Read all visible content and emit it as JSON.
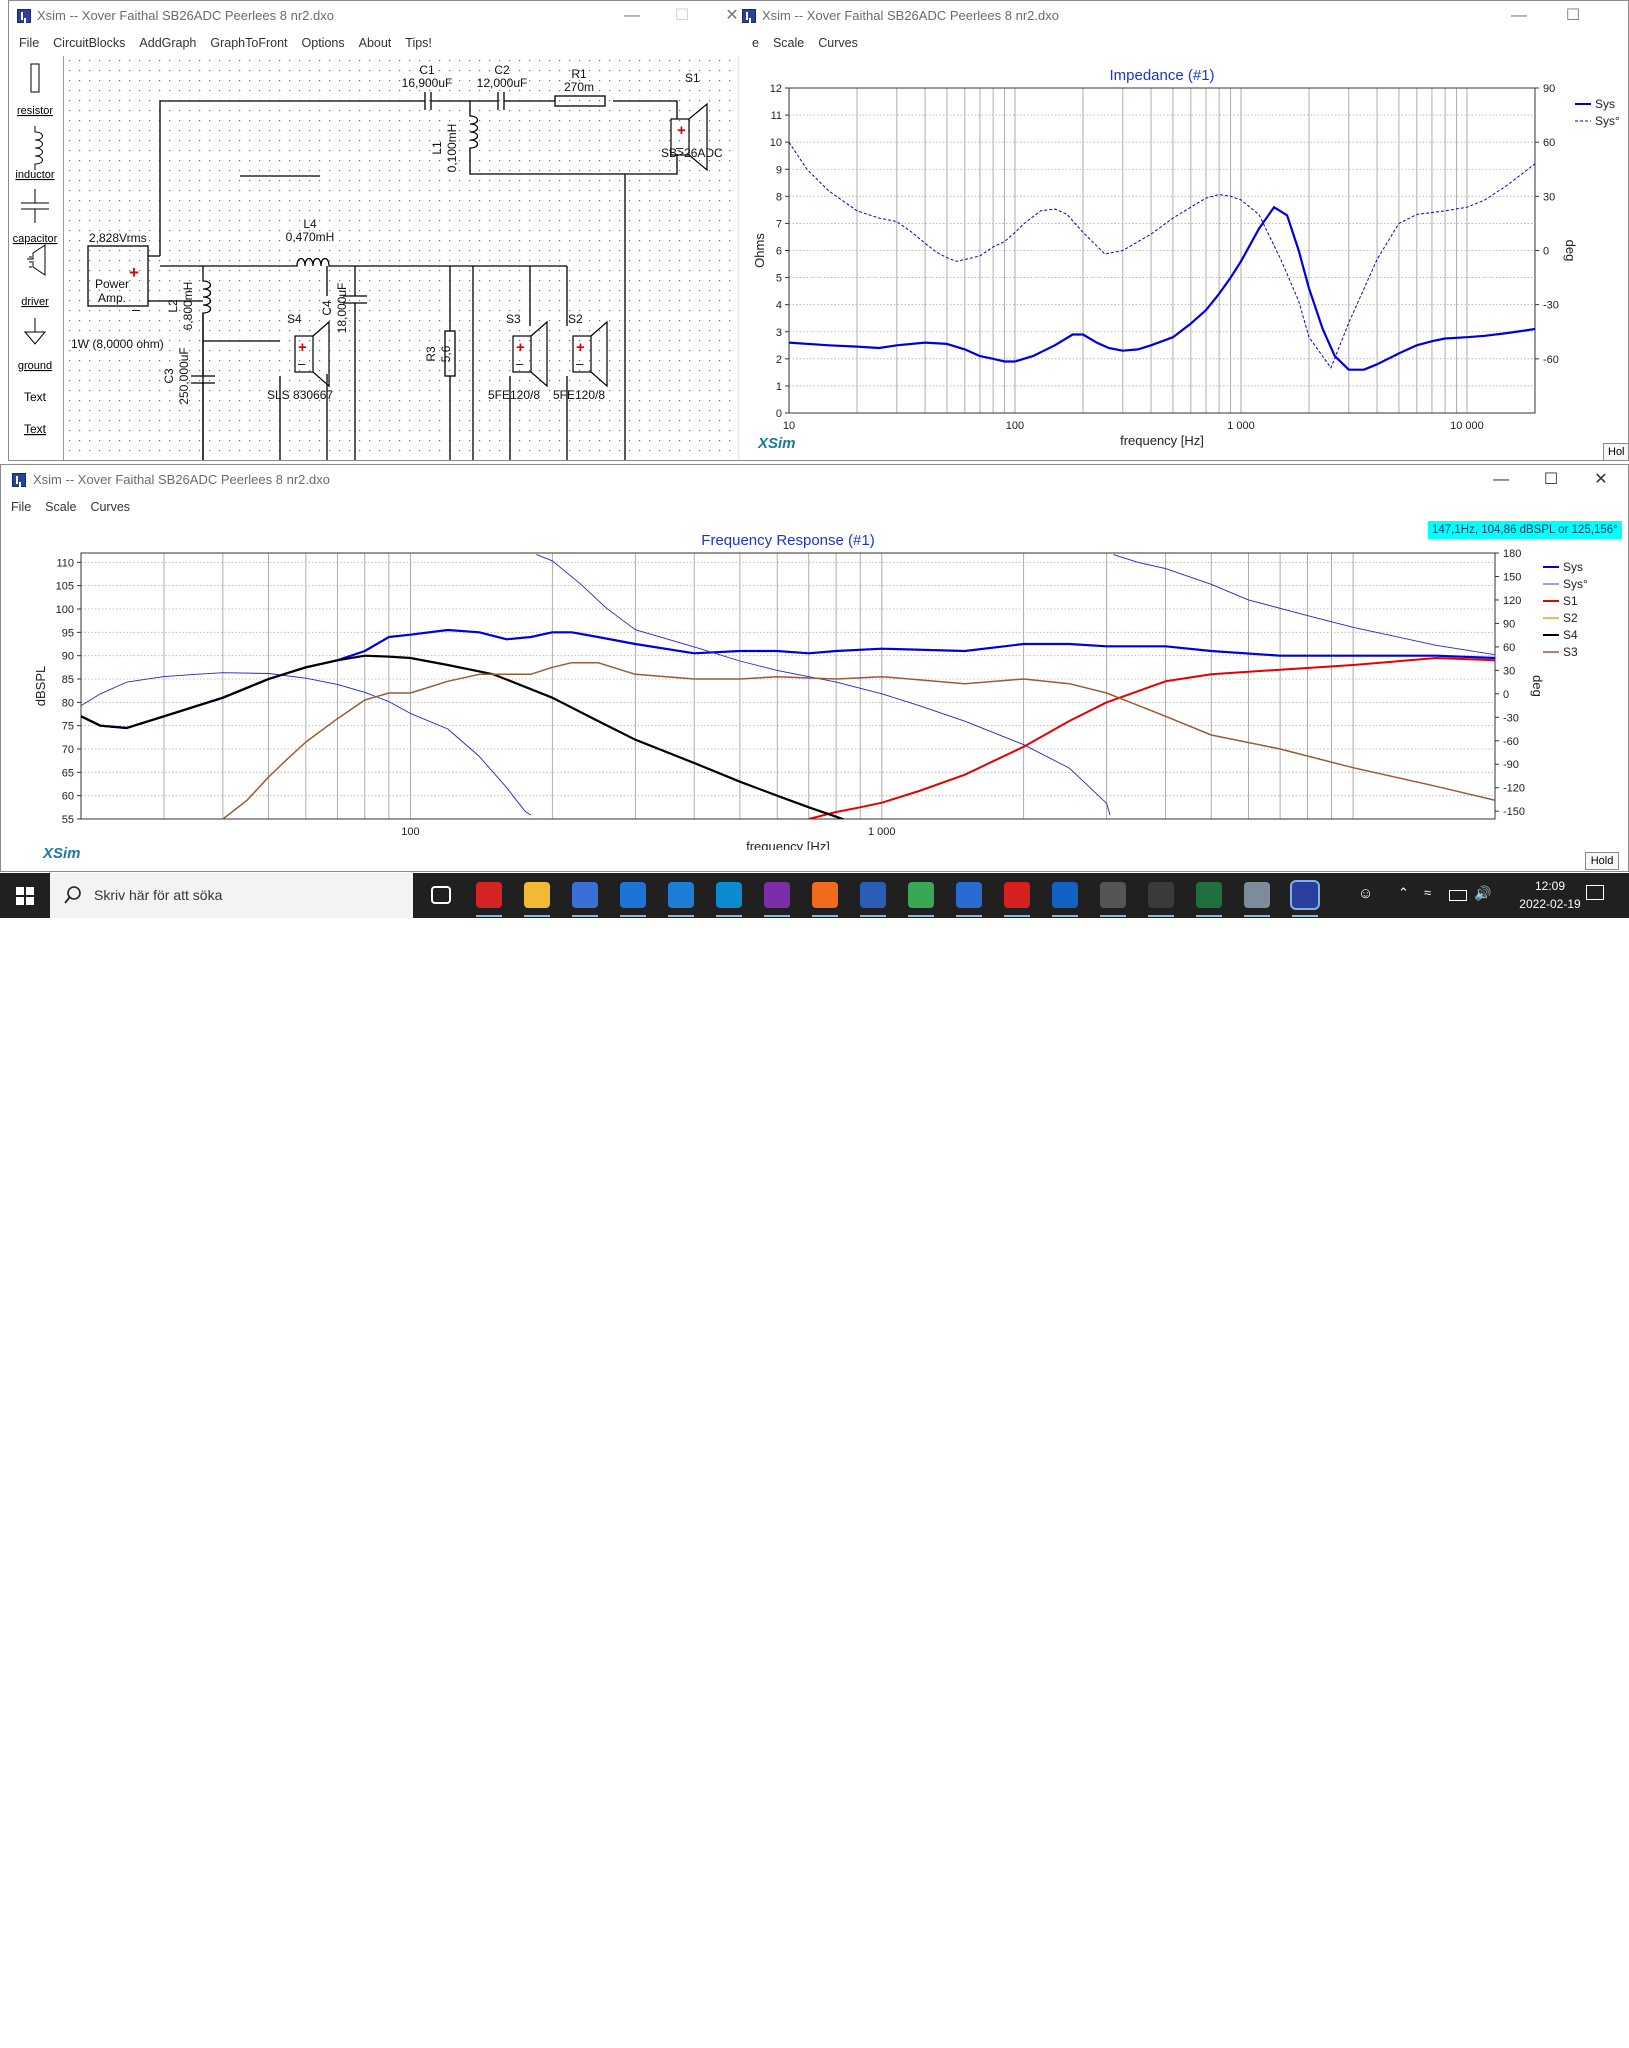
{
  "circuit_window": {
    "title": "Xsim -- Xover Faithal SB26ADC Peerlees 8 nr2.dxo",
    "menu": [
      "File",
      "CircuitBlocks",
      "AddGraph",
      "GraphToFront",
      "Options",
      "About",
      "Tips!"
    ],
    "palette": [
      "resistor",
      "inductor",
      "capacitor",
      "driver",
      "ground",
      "Text",
      "Text"
    ],
    "components": {
      "c1": {
        "name": "C1",
        "value": "16,900uF"
      },
      "c2": {
        "name": "C2",
        "value": "12,000uF"
      },
      "r1": {
        "name": "R1",
        "value": "270m"
      },
      "s1": {
        "name": "S1",
        "model": "SB>26ADC"
      },
      "l1": {
        "name": "L1",
        "value": "0,100mH"
      },
      "l4": {
        "name": "L4",
        "value": "0,470mH"
      },
      "l2": {
        "name": "L2",
        "value": "6,800mH"
      },
      "c3": {
        "name": "C3",
        "value": "250,000uF"
      },
      "c4": {
        "name": "C4",
        "value": "18,000uF"
      },
      "s4": {
        "name": "S4",
        "model": "SLS 830667"
      },
      "r3": {
        "name": "R3",
        "value": "5,6"
      },
      "s3": {
        "name": "S3",
        "model": "5FE120/8"
      },
      "s2": {
        "name": "S2",
        "model": "5FE120/8"
      },
      "amp": {
        "voltage": "2,828Vrms",
        "label_line1": "Power",
        "label_line2": "Amp.",
        "power": "1W (8,0000 ohm)"
      }
    }
  },
  "impedance_window": {
    "title": "Xsim -- Xover Faithal SB26ADC Peerlees 8 nr2.dxo",
    "menu": [
      "e",
      "Scale",
      "Curves"
    ],
    "brand": "XSim",
    "hold": "Hol"
  },
  "response_window": {
    "title": "Xsim -- Xover Faithal SB26ADC Peerlees 8 nr2.dxo",
    "menu": [
      "File",
      "Scale",
      "Curves"
    ],
    "brand": "XSim",
    "hold": "Hold",
    "readout": "147,1Hz, 104,86 dBSPL or 125,156°"
  },
  "taskbar": {
    "search_placeholder": "Skriv här för att söka",
    "time": "12:09",
    "date": "2022-02-19",
    "icons": [
      "task-view",
      "red-app",
      "file-explorer",
      "store",
      "mail",
      "edge",
      "lync",
      "onenote",
      "firefox",
      "word",
      "chrome",
      "photos",
      "acrobat",
      "outlook",
      "calculator",
      "dial",
      "rew",
      "network-tool",
      "xsim"
    ]
  },
  "chart_data": [
    {
      "type": "line",
      "title": "Impedance (#1)",
      "xlabel": "frequency [Hz]",
      "ylabel": "Ohms",
      "y2label": "deg",
      "x_scale": "log",
      "xlim": [
        10,
        20000
      ],
      "ylim": [
        0,
        12
      ],
      "y2lim": [
        -90,
        90
      ],
      "x_ticks": [
        "10",
        "100",
        "1 000",
        "10 000"
      ],
      "y_ticks": [
        "0",
        "1",
        "2",
        "3",
        "4",
        "5",
        "6",
        "7",
        "8",
        "9",
        "10",
        "11",
        "12"
      ],
      "y2_ticks": [
        "-60",
        "-30",
        "0",
        "30",
        "60",
        "90"
      ],
      "grid": true,
      "legend": "top-right",
      "series": [
        {
          "name": "Sys",
          "axis": "left",
          "color": "#0000dd",
          "style": "solid",
          "width": 2.2,
          "x": [
            10,
            15,
            20,
            25,
            30,
            40,
            50,
            60,
            70,
            80,
            90,
            100,
            120,
            150,
            180,
            200,
            230,
            260,
            300,
            350,
            400,
            500,
            600,
            700,
            800,
            900,
            1000,
            1200,
            1400,
            1600,
            1800,
            2000,
            2300,
            2600,
            3000,
            3500,
            4000,
            5000,
            6000,
            7000,
            8000,
            10000,
            12000,
            15000,
            20000
          ],
          "y": [
            2.6,
            2.5,
            2.45,
            2.4,
            2.5,
            2.6,
            2.55,
            2.35,
            2.1,
            2.0,
            1.9,
            1.9,
            2.1,
            2.5,
            2.9,
            2.9,
            2.6,
            2.4,
            2.3,
            2.35,
            2.5,
            2.8,
            3.3,
            3.8,
            4.4,
            5.0,
            5.6,
            6.8,
            7.6,
            7.3,
            6.0,
            4.6,
            3.1,
            2.1,
            1.6,
            1.6,
            1.8,
            2.2,
            2.5,
            2.65,
            2.75,
            2.8,
            2.85,
            2.95,
            3.1
          ]
        },
        {
          "name": "Sys°",
          "axis": "right",
          "color": "#0000dd",
          "style": "dashed",
          "width": 1,
          "x": [
            10,
            12,
            15,
            20,
            25,
            30,
            35,
            40,
            45,
            50,
            55,
            60,
            70,
            80,
            90,
            100,
            110,
            130,
            150,
            170,
            200,
            250,
            300,
            400,
            500,
            600,
            700,
            800,
            900,
            1000,
            1200,
            1500,
            1800,
            2000,
            2500,
            3000,
            4000,
            5000,
            6000,
            8000,
            10000,
            12000,
            15000,
            20000
          ],
          "y": [
            60,
            45,
            33,
            22,
            18,
            16,
            10,
            4,
            -1,
            -4,
            -6,
            -5,
            -3,
            2,
            5,
            10,
            15,
            22,
            23,
            20,
            10,
            -2,
            0,
            9,
            18,
            24,
            29,
            31,
            30,
            28,
            20,
            -5,
            -28,
            -48,
            -65,
            -40,
            -5,
            15,
            20,
            22,
            24,
            28,
            36,
            48
          ]
        }
      ]
    },
    {
      "type": "line",
      "title": "Frequency Response (#1)",
      "xlabel": "frequency [Hz]",
      "ylabel": "dBSPL",
      "y2label": "deg",
      "x_scale": "log",
      "xlim": [
        20,
        20000
      ],
      "ylim": [
        55,
        112
      ],
      "y2lim": [
        -160,
        180
      ],
      "x_ticks": [
        "100",
        "1 000"
      ],
      "y_ticks": [
        "55",
        "60",
        "65",
        "70",
        "75",
        "80",
        "85",
        "90",
        "95",
        "100",
        "105",
        "110"
      ],
      "y2_ticks": [
        "-150",
        "-120",
        "-90",
        "-60",
        "-30",
        "0",
        "30",
        "60",
        "90",
        "120",
        "150",
        "180"
      ],
      "grid": true,
      "legend": "top-right",
      "series": [
        {
          "name": "Sys",
          "axis": "left",
          "color": "#0000dd",
          "style": "solid",
          "width": 2.2,
          "x": [
            20,
            22,
            25,
            30,
            40,
            50,
            60,
            70,
            80,
            90,
            100,
            120,
            140,
            160,
            180,
            200,
            220,
            250,
            300,
            400,
            500,
            600,
            700,
            800,
            1000,
            1500,
            2000,
            2500,
            3000,
            4000,
            5000,
            7000,
            10000,
            15000,
            20000
          ],
          "y": [
            77,
            75,
            74.5,
            77,
            81,
            85,
            87.5,
            89,
            91,
            94,
            94.5,
            95.5,
            95,
            93.5,
            94,
            95,
            95,
            94,
            92.5,
            90.5,
            91,
            91,
            90.5,
            91,
            91.5,
            91,
            92.5,
            92.5,
            92,
            92,
            91,
            90,
            90,
            90,
            89.5
          ]
        },
        {
          "name": "Sys°",
          "axis": "right",
          "color": "#2222dd",
          "style": "solid",
          "width": 0.9,
          "x": [
            20,
            22,
            25,
            30,
            35,
            40,
            50,
            60,
            70,
            80,
            90,
            100,
            120,
            140,
            160,
            175,
            180,
            185,
            200,
            230,
            260,
            300,
            400,
            500,
            600,
            800,
            1000,
            1200,
            1500,
            2000,
            2500,
            3000,
            3050,
            3100,
            3500,
            4000,
            5000,
            6000,
            8000,
            10000,
            15000,
            20000
          ],
          "y": [
            -15,
            0,
            15,
            22,
            25,
            27,
            26,
            20,
            12,
            2,
            -10,
            -25,
            -45,
            -80,
            -120,
            -150,
            -155,
            178,
            170,
            140,
            110,
            82,
            60,
            42,
            30,
            15,
            0,
            -15,
            -35,
            -65,
            -95,
            -140,
            -155,
            178,
            168,
            160,
            140,
            120,
            100,
            85,
            62,
            50
          ]
        },
        {
          "name": "S1",
          "axis": "left",
          "color": "#e60000",
          "style": "solid",
          "width": 2,
          "x": [
            700,
            800,
            900,
            1000,
            1200,
            1500,
            2000,
            2500,
            3000,
            4000,
            5000,
            7000,
            10000,
            15000,
            20000
          ],
          "y": [
            55,
            56.5,
            57.5,
            58.5,
            61,
            64.5,
            70.5,
            76,
            80,
            84.5,
            86,
            87,
            88,
            89.5,
            89
          ]
        },
        {
          "name": "S2",
          "axis": "left",
          "color": "#f0a020",
          "style": "solid",
          "width": 1.5,
          "x": [],
          "y": []
        },
        {
          "name": "S4",
          "axis": "left",
          "color": "#000000",
          "style": "solid",
          "width": 2.2,
          "x": [
            20,
            22,
            25,
            30,
            40,
            50,
            60,
            70,
            80,
            90,
            100,
            120,
            150,
            200,
            250,
            300,
            400,
            500,
            600,
            700,
            800,
            850
          ],
          "y": [
            77,
            75,
            74.5,
            77,
            81,
            85,
            87.5,
            89,
            90,
            89.8,
            89.5,
            88,
            86,
            81,
            76,
            72,
            67,
            63,
            60,
            57.5,
            55.5,
            54.5
          ]
        },
        {
          "name": "S3",
          "axis": "left",
          "color": "#9a5a36",
          "style": "solid",
          "width": 1.5,
          "x": [
            40,
            45,
            50,
            55,
            60,
            70,
            80,
            90,
            100,
            120,
            140,
            160,
            180,
            200,
            220,
            250,
            300,
            400,
            500,
            600,
            800,
            1000,
            1500,
            2000,
            2500,
            3000,
            4000,
            5000,
            7000,
            10000,
            15000,
            20000
          ],
          "y": [
            55,
            59,
            64,
            68,
            71.5,
            76.5,
            80.5,
            82,
            82,
            84.5,
            86,
            86,
            86,
            87.5,
            88.5,
            88.5,
            86,
            85,
            85,
            85.5,
            85,
            85.5,
            84,
            85,
            84,
            82,
            77,
            73,
            70,
            66,
            62,
            59
          ]
        }
      ]
    }
  ]
}
